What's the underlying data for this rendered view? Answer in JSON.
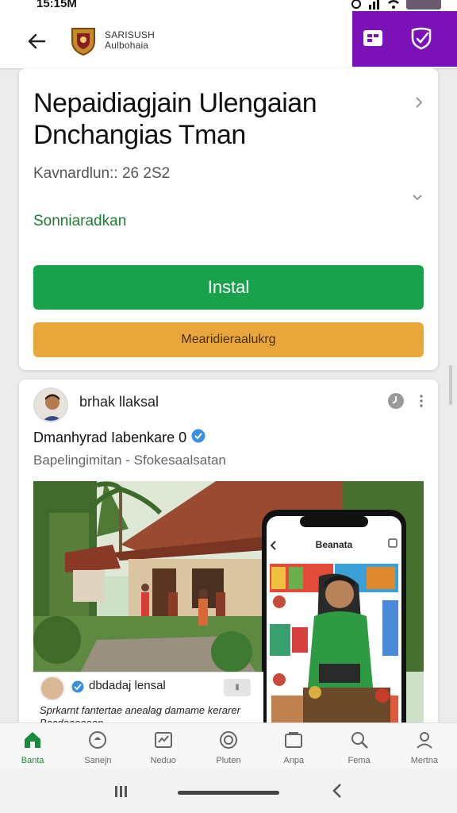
{
  "status": {
    "time": "15:15M"
  },
  "app_bar": {
    "name_line1": "SARISUSH",
    "name_line2": "Aulbohaia"
  },
  "listing": {
    "title": "Nepaidiagjain Ulengaian Dnchangias Tman",
    "meta": "Kavnardlun:: 26 2S2",
    "developer": "Sonniaradkan",
    "install_label": "Instal",
    "secondary_label": "Mearidieraalukrg"
  },
  "post": {
    "poster_name": "brhak llaksal",
    "title": "Dmanhyrad Iabenkare 0",
    "subtitle": "Bapelingimitan - Sfokesaalsatan",
    "phone_screen_title": "Beanata",
    "caption_name": "dbdadaj lensal",
    "caption_text": "Sprkarnt fantertae anealag damame kerarer Bacdaaeeeen"
  },
  "bottom_nav": [
    {
      "label": "Banta",
      "icon": "home-icon"
    },
    {
      "label": "Sanejn",
      "icon": "games-icon"
    },
    {
      "label": "Neduo",
      "icon": "movies-icon"
    },
    {
      "label": "Pluten",
      "icon": "compass-icon"
    },
    {
      "label": "Anpa",
      "icon": "apps-icon"
    },
    {
      "label": "Fema",
      "icon": "search-icon"
    },
    {
      "label": "Mertna",
      "icon": "account-icon"
    }
  ],
  "colors": {
    "brand_purple": "#7b12b8",
    "install_green": "#18a24b",
    "secondary_orange": "#e9a73b",
    "active_nav": "#1a8a3c"
  }
}
